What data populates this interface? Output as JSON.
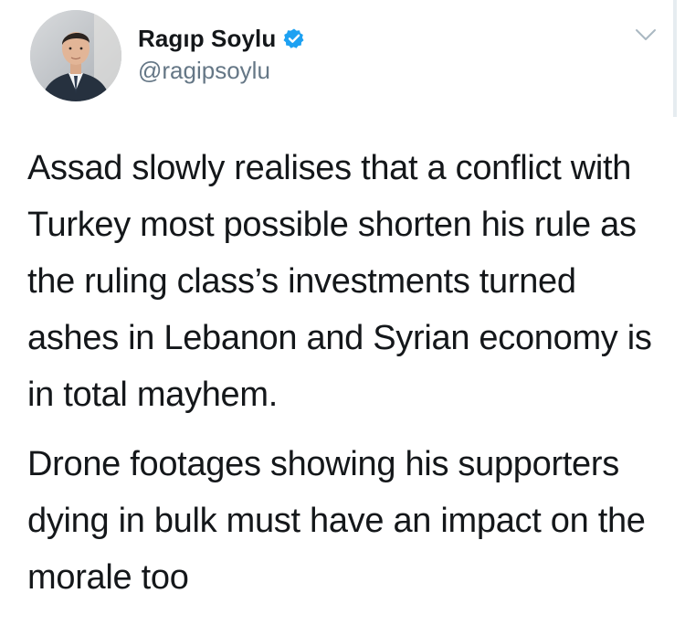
{
  "author": {
    "display_name": "Ragıp Soylu",
    "handle": "@ragipsoylu",
    "verified": true,
    "verified_icon": "verified-badge-icon",
    "avatar_icon": "profile-photo"
  },
  "tweet": {
    "paragraphs": [
      "Assad slowly realises that a conflict with Turkey most possible shorten his rule as the ruling class’s investments turned ashes in Lebanon and Syrian economy is in total mayhem.",
      "Drone footages showing his supporters dying in bulk must have an impact on the morale too"
    ]
  },
  "menu": {
    "icon": "chevron-down-icon"
  },
  "colors": {
    "verified_blue": "#1da1f2",
    "handle_gray": "#657786",
    "text_dark": "#14171a"
  }
}
